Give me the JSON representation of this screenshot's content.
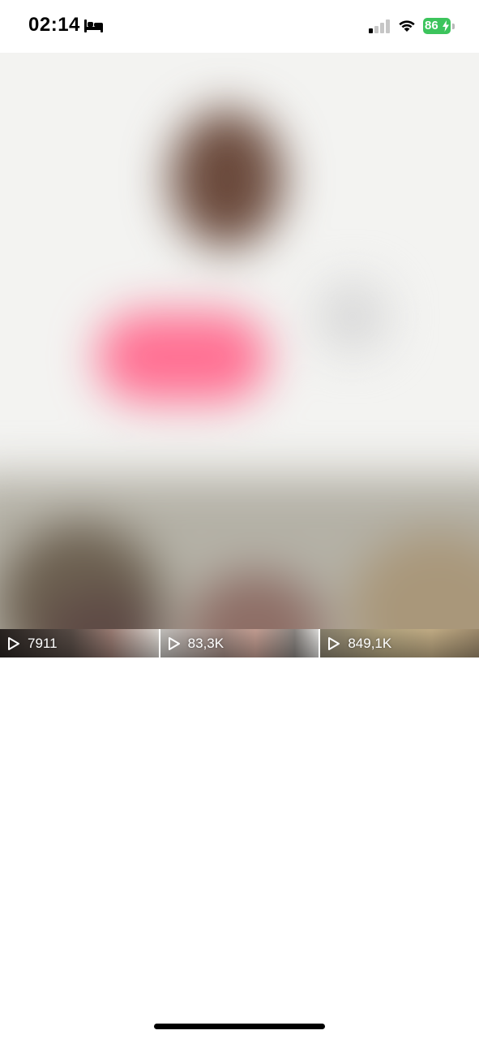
{
  "status_bar": {
    "time": "02:14",
    "focus_icon": "bed-icon",
    "signal_icon": "cellular-signal-icon",
    "wifi_icon": "wifi-icon",
    "battery_percent": "86",
    "battery_charging": true,
    "battery_color": "#3cc45c"
  },
  "media": {
    "accent_color": "#ff6f92"
  },
  "videos": [
    {
      "views": "7911"
    },
    {
      "views": "83,3K"
    },
    {
      "views": "849,1K"
    }
  ]
}
